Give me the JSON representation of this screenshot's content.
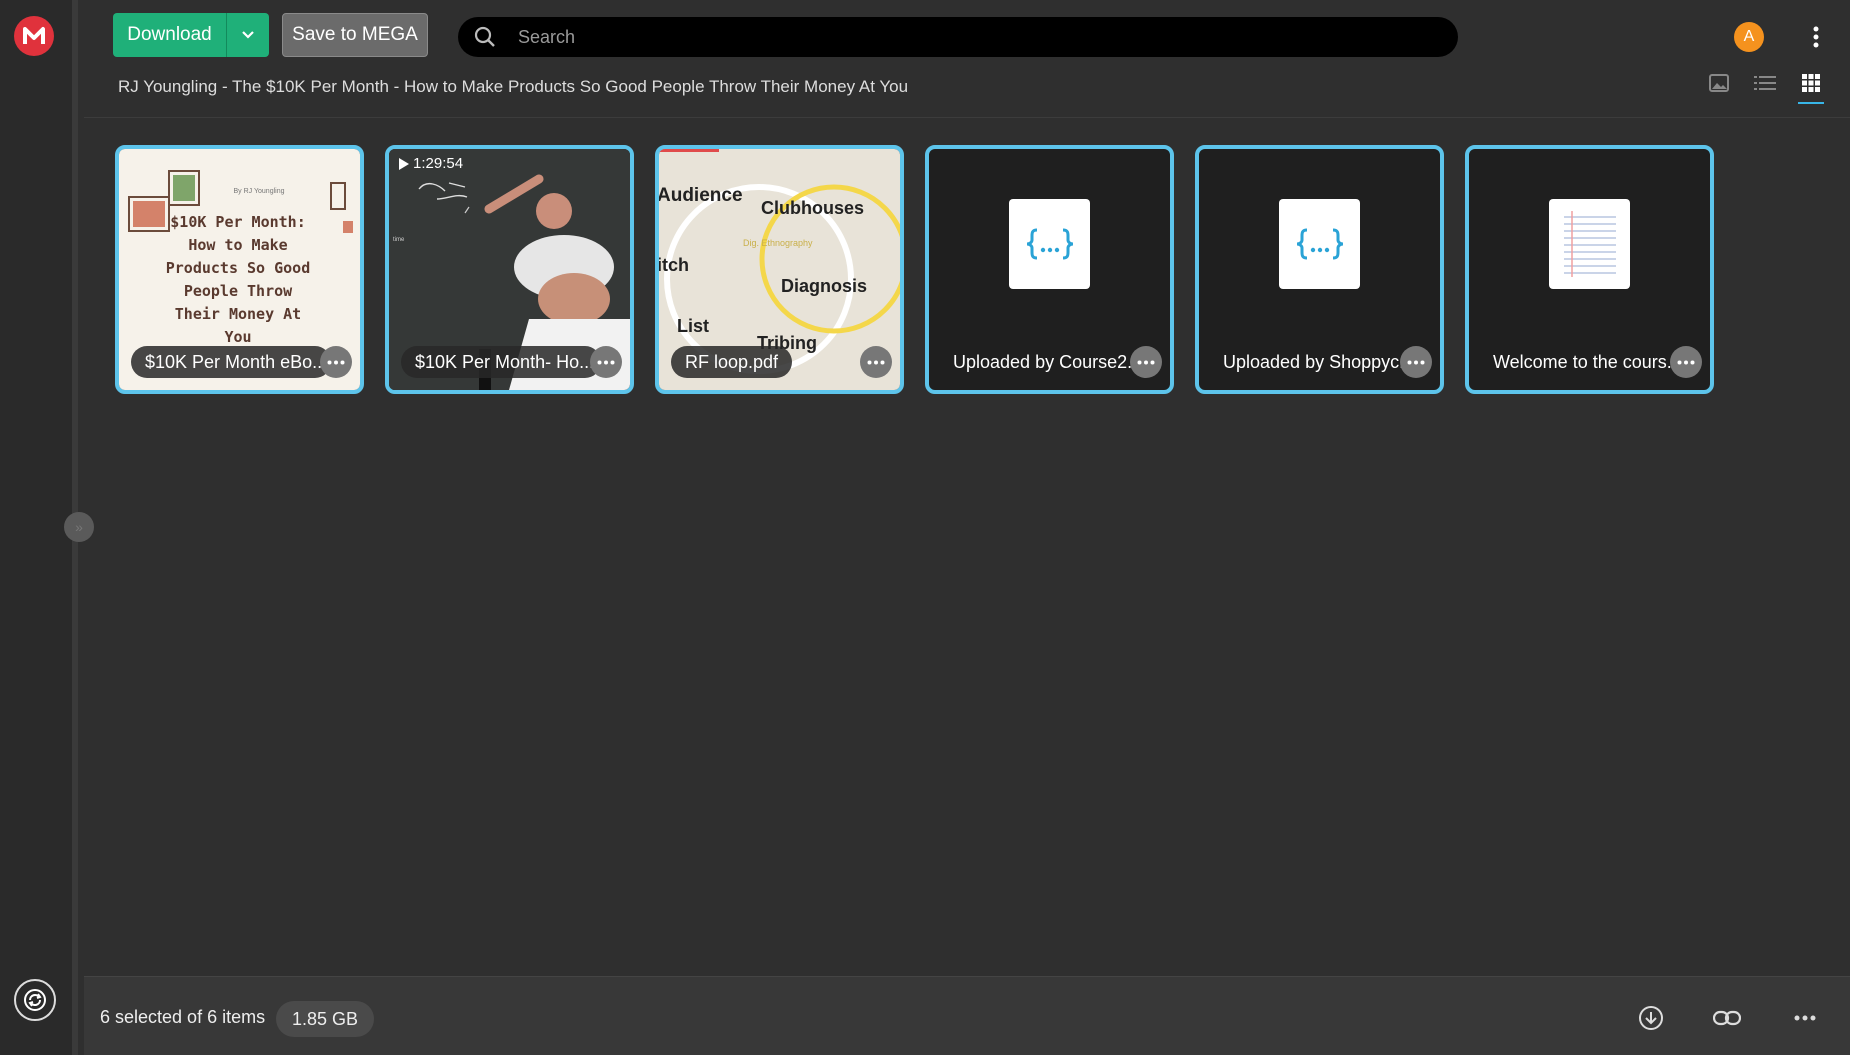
{
  "toolbar": {
    "download_label": "Download",
    "save_label": "Save to MEGA"
  },
  "search": {
    "placeholder": "Search"
  },
  "user": {
    "avatar_initial": "A"
  },
  "breadcrumb": "RJ Youngling - The $10K Per Month - How to Make Products So Good People Throw Their Money At You",
  "files": [
    {
      "name": "$10K Per Month eBo...",
      "type": "ebook-cover"
    },
    {
      "name": "$10K Per Month- Ho...",
      "type": "video",
      "duration": "1:29:54"
    },
    {
      "name": "RF loop.pdf",
      "type": "pdf-diagram"
    },
    {
      "name": "Uploaded by Course2...",
      "type": "code-file"
    },
    {
      "name": "Uploaded by Shoppyc...",
      "type": "code-file"
    },
    {
      "name": "Welcome to the cours...",
      "type": "text-file"
    }
  ],
  "ebook_cover": {
    "text": "$10K Per Month: How to Make Products So Good People Throw Their Money At You",
    "byline": "By RJ Youngling"
  },
  "diagram": {
    "labels": [
      "Audience",
      "Clubhouses",
      "Dig. Ethnography",
      "itch",
      "Diagnosis",
      "List",
      "Tribing"
    ]
  },
  "footer": {
    "selection": "6 selected of 6 items",
    "size": "1.85 GB"
  },
  "colors": {
    "accent": "#5dc4eb",
    "download_green": "#1fb079",
    "logo_red": "#e0323c",
    "avatar_orange": "#f5921e"
  }
}
